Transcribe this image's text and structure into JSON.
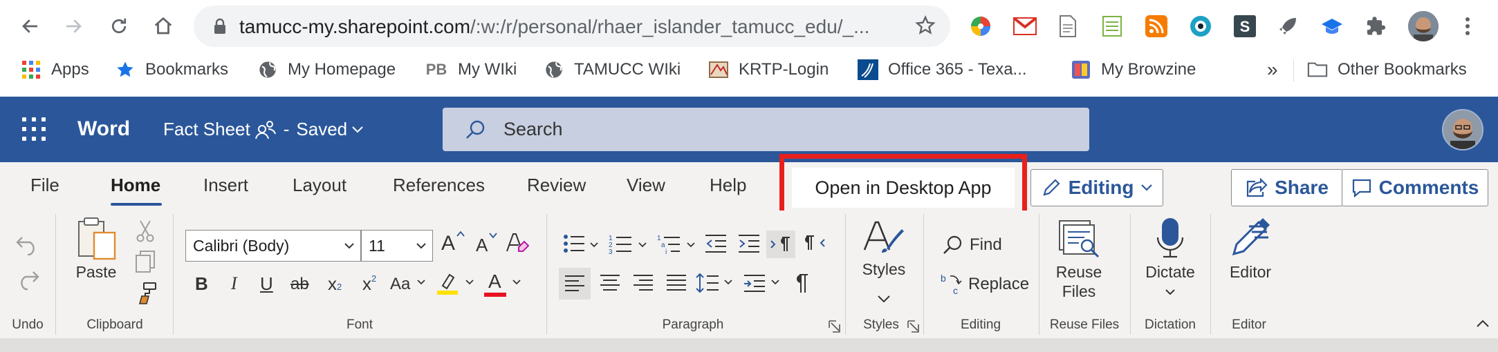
{
  "browser": {
    "url_host": "tamucc-my.sharepoint.com",
    "url_path": "/:w:/r/personal/rhaer_islander_tamucc_edu/_...",
    "bookmarks": [
      {
        "label": "Apps",
        "icon": "apps-grid-icon"
      },
      {
        "label": "Bookmarks",
        "icon": "star-icon"
      },
      {
        "label": "My Homepage",
        "icon": "globe-icon"
      },
      {
        "label": "My WIki",
        "icon": "pb-icon"
      },
      {
        "label": "TAMUCC WIki",
        "icon": "globe-icon"
      },
      {
        "label": "KRTP-Login",
        "icon": "krtp-icon"
      },
      {
        "label": "Office 365 - Texa...",
        "icon": "office365-icon"
      },
      {
        "label": "My Browzine",
        "icon": "browzine-icon"
      }
    ],
    "bookmarks_overflow": "»",
    "other_bookmarks": "Other Bookmarks"
  },
  "word": {
    "app_name": "Word",
    "doc_title": "Fact Sheet",
    "save_status": "Saved",
    "search_placeholder": "Search"
  },
  "tabs": [
    {
      "label": "File",
      "active": false
    },
    {
      "label": "Home",
      "active": true
    },
    {
      "label": "Insert",
      "active": false
    },
    {
      "label": "Layout",
      "active": false
    },
    {
      "label": "References",
      "active": false
    },
    {
      "label": "Review",
      "active": false
    },
    {
      "label": "View",
      "active": false
    },
    {
      "label": "Help",
      "active": false
    }
  ],
  "open_desktop_label": "Open in Desktop App",
  "editing_mode_label": "Editing",
  "share_label": "Share",
  "comments_label": "Comments",
  "ribbon": {
    "paste_label": "Paste",
    "font_name": "Calibri (Body)",
    "font_size": "11",
    "styles_label": "Styles",
    "find_label": "Find",
    "replace_label": "Replace",
    "reuse_files_label_1": "Reuse",
    "reuse_files_label_2": "Files",
    "dictate_label": "Dictate",
    "editor_label": "Editor",
    "text_icons": {
      "grow": "A",
      "shrink": "A",
      "bold": "B",
      "italic": "I",
      "underline": "U",
      "strike": "ab",
      "subscript": "x",
      "superscript": "x",
      "change_case": "Aa",
      "font_color": "A"
    },
    "groups": {
      "undo": "Undo",
      "clipboard": "Clipboard",
      "font": "Font",
      "paragraph": "Paragraph",
      "styles": "Styles",
      "editing": "Editing",
      "reuse_files": "Reuse Files",
      "dictation": "Dictation",
      "editor": "Editor"
    }
  },
  "colors": {
    "word_blue": "#2b579a",
    "highlight_red": "#e8201c",
    "highlight_yellow": "#ffe100",
    "font_color_red": "#e81123"
  }
}
